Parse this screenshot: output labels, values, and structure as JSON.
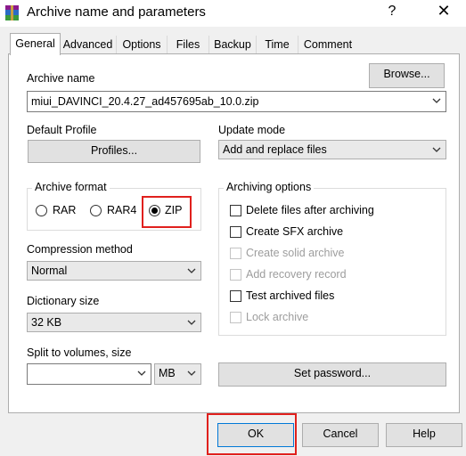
{
  "window": {
    "title": "Archive name and parameters",
    "help": "?",
    "close": "✕"
  },
  "tabs": [
    {
      "label": "General"
    },
    {
      "label": "Advanced"
    },
    {
      "label": "Options"
    },
    {
      "label": "Files"
    },
    {
      "label": "Backup"
    },
    {
      "label": "Time"
    },
    {
      "label": "Comment"
    }
  ],
  "archive_name": {
    "label": "Archive name",
    "browse_label": "Browse...",
    "value": "miui_DAVINCI_20.4.27_ad457695ab_10.0.zip"
  },
  "profile": {
    "label": "Default Profile",
    "button": "Profiles..."
  },
  "update_mode": {
    "label": "Update mode",
    "value": "Add and replace files"
  },
  "archive_format": {
    "label": "Archive format",
    "options": [
      "RAR",
      "RAR4",
      "ZIP"
    ],
    "selected": "ZIP"
  },
  "archiving_options": {
    "label": "Archiving options",
    "items": [
      {
        "label": "Delete files after archiving",
        "enabled": true,
        "checked": false
      },
      {
        "label": "Create SFX archive",
        "enabled": true,
        "checked": false
      },
      {
        "label": "Create solid archive",
        "enabled": false,
        "checked": false
      },
      {
        "label": "Add recovery record",
        "enabled": false,
        "checked": false
      },
      {
        "label": "Test archived files",
        "enabled": true,
        "checked": false
      },
      {
        "label": "Lock archive",
        "enabled": false,
        "checked": false
      }
    ]
  },
  "compression": {
    "label": "Compression method",
    "value": "Normal"
  },
  "dictionary": {
    "label": "Dictionary size",
    "value": "32 KB"
  },
  "split": {
    "label": "Split to volumes, size",
    "value": "",
    "unit": "MB"
  },
  "password_button": "Set password...",
  "buttons": {
    "ok": "OK",
    "cancel": "Cancel",
    "help": "Help"
  },
  "colors": {
    "highlight": "#e0201d"
  }
}
